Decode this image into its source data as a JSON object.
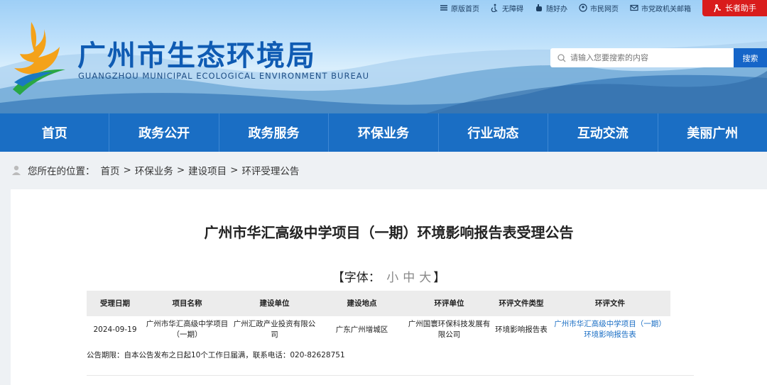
{
  "header": {
    "top_links": [
      {
        "label": "原版首页",
        "icon": "home-icon"
      },
      {
        "label": "无障碍",
        "icon": "accessibility-icon"
      },
      {
        "label": "随好办",
        "icon": "hand-icon"
      },
      {
        "label": "市民网页",
        "icon": "globe-icon"
      },
      {
        "label": "市党政机关邮箱",
        "icon": "mail-icon"
      }
    ],
    "elder_button": "长者助手",
    "site_title": "广州市生态环境局",
    "site_subtitle": "GUANGZHOU MUNICIPAL ECOLOGICAL ENVIRONMENT BUREAU",
    "search_placeholder": "请输入您要搜索的内容",
    "search_button": "搜索"
  },
  "nav": [
    "首页",
    "政务公开",
    "政务服务",
    "环保业务",
    "行业动态",
    "互动交流",
    "美丽广州"
  ],
  "breadcrumb": {
    "prefix": "您所在的位置：",
    "items": [
      "首页",
      "环保业务",
      "建设项目",
      "环评受理公告"
    ],
    "separator": ">"
  },
  "article": {
    "title": "广州市华汇高级中学项目（一期）环境影响报告表受理公告",
    "font_size": {
      "open": "【",
      "label": "字体：",
      "small": "小",
      "medium": "中",
      "large": "大",
      "close": "】"
    },
    "table": {
      "headers": [
        "受理日期",
        "项目名称",
        "建设单位",
        "建设地点",
        "环评单位",
        "环评文件类型",
        "环评文件"
      ],
      "rows": [
        [
          "2024-09-19",
          "广州市华汇高级中学项目（一期）",
          "广州汇政产业投资有限公司",
          "广东广州增城区",
          "广州国寰环保科技发展有限公司",
          "环境影响报告表",
          "广州市华汇高级中学项目（一期）环境影响报告表"
        ]
      ]
    },
    "period_text": "公告期限：自本公告发布之日起10个工作日届满，联系电话：020-82628751"
  },
  "colors": {
    "nav_bg": "#1a6ec4",
    "title_blue": "#0f5bb3",
    "elder_red": "#d91c1c",
    "link_blue": "#1a6ec4"
  }
}
